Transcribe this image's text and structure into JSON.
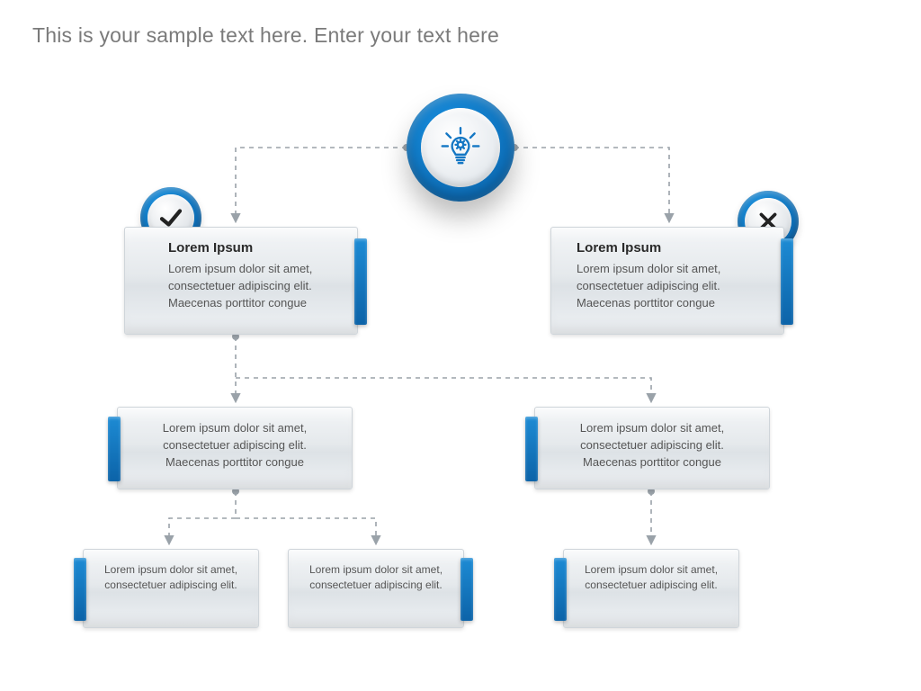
{
  "sample_text": "This is your sample text here. Enter your text here",
  "icons": {
    "main": "lightbulb-gear-icon",
    "yes": "check-icon",
    "no": "cross-icon"
  },
  "colors": {
    "accent": "#0f74bd",
    "panel": "#e8ecef"
  },
  "panels": {
    "p1": {
      "title": "Lorem Ipsum",
      "body": "Lorem ipsum dolor sit amet, consectetuer adipiscing elit. Maecenas porttitor congue"
    },
    "p2": {
      "title": "Lorem Ipsum",
      "body": "Lorem ipsum dolor sit amet, consectetuer adipiscing elit. Maecenas porttitor congue"
    },
    "p3": {
      "body": "Lorem ipsum dolor sit amet, consectetuer adipiscing elit. Maecenas porttitor congue"
    },
    "p4": {
      "body": "Lorem ipsum dolor sit amet, consectetuer adipiscing elit. Maecenas porttitor congue"
    },
    "p5": {
      "body": "Lorem ipsum dolor sit amet, consectetuer adipiscing elit."
    },
    "p6": {
      "body": "Lorem ipsum dolor sit amet, consectetuer adipiscing elit."
    },
    "p7": {
      "body": "Lorem ipsum dolor sit amet, consectetuer adipiscing elit."
    }
  }
}
